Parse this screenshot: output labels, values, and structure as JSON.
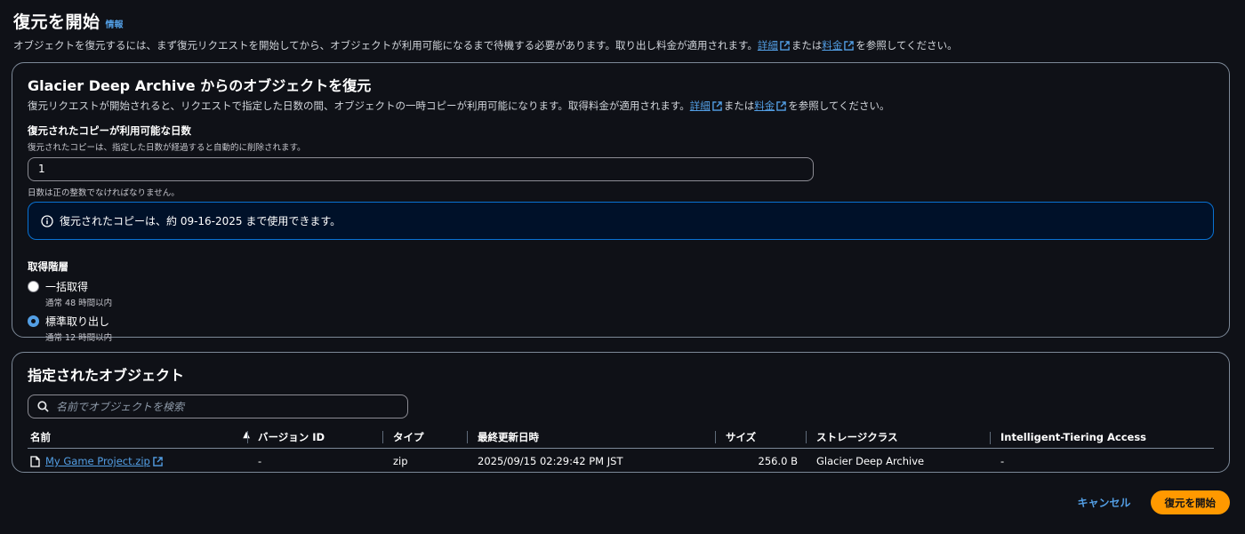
{
  "header": {
    "title": "復元を開始",
    "info": "情報",
    "desc_pre": "オブジェクトを復元するには、まず復元リクエストを開始してから、オブジェクトが利用可能になるまで待機する必要があります。取り出し料金が適用されます。",
    "link_details": "詳細",
    "desc_mid": "または",
    "link_pricing": "料金",
    "desc_post": "を参照してください。"
  },
  "restore_panel": {
    "title": "Glacier Deep Archive からのオブジェクトを復元",
    "desc_pre": "復元リクエストが開始されると、リクエストで指定した日数の間、オブジェクトの一時コピーが利用可能になります。取得料金が適用されます。",
    "link_details": "詳細",
    "desc_mid": "または",
    "link_pricing": "料金",
    "desc_post": "を参照してください。",
    "days_label": "復元されたコピーが利用可能な日数",
    "days_desc": "復元されたコピーは、指定した日数が経過すると自動的に削除されます。",
    "days_value": "1",
    "days_constraint": "日数は正の整数でなければなりません。",
    "alert_text": "復元されたコピーは、約 09-16-2025 まで使用できます。",
    "tier_label": "取得階層",
    "tiers": [
      {
        "label": "一括取得",
        "desc": "通常 48 時間以内",
        "checked": false
      },
      {
        "label": "標準取り出し",
        "desc": "通常 12 時間以内",
        "checked": true
      }
    ]
  },
  "objects_panel": {
    "title": "指定されたオブジェクト",
    "search_placeholder": "名前でオブジェクトを検索",
    "columns": [
      "名前",
      "バージョン ID",
      "タイプ",
      "最終更新日時",
      "サイズ",
      "ストレージクラス",
      "Intelligent-Tiering Access"
    ],
    "sort_indicator": "▲",
    "rows": [
      {
        "name": "My Game Project.zip",
        "version": "-",
        "type": "zip",
        "modified": "2025/09/15 02:29:42 PM JST",
        "size": "256.0 B",
        "storage_class": "Glacier Deep Archive",
        "tiering": "-"
      }
    ]
  },
  "footer": {
    "cancel": "キャンセル",
    "submit": "復元を開始"
  },
  "colors": {
    "background": "#0f1117",
    "link": "#539fe5",
    "primary": "#ff9900",
    "info_border": "#0972d3"
  }
}
